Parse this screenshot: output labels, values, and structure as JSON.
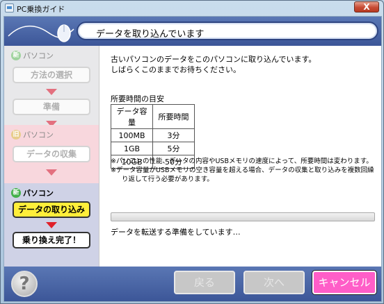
{
  "window": {
    "title": "PC乗換ガイド",
    "close_label": "X"
  },
  "header": {
    "title": "データを取り込んでいます"
  },
  "sidebar": {
    "new1_label": "パソコン",
    "new1_badge": "新",
    "step_method": "方法の選択",
    "step_prepare": "準備",
    "old_label": "パソコン",
    "old_badge": "旧",
    "step_collect": "データの収集",
    "new2_label": "パソコン",
    "new2_badge": "新",
    "step_import": "データの取り込み",
    "step_complete": "乗り換え完了！"
  },
  "main": {
    "message_line1": "古いパソコンのデータをこのパソコンに取り込んでいます。",
    "message_line2": "しばらくこのままでお待ちください。",
    "time_title": "所要時間の目安",
    "table": {
      "headers": [
        "データ容量",
        "所要時間"
      ],
      "rows": [
        [
          "100MB",
          "3分"
        ],
        [
          "1GB",
          "5分"
        ],
        [
          "10GB",
          "50分"
        ]
      ]
    },
    "note1": "※パソコンの性能、データの内容やUSBメモリの速度によって、所要時間は変わります。",
    "note2": "※データ容量がUSBメモリの空き容量を超える場合、データの収集と取り込みを複数回繰り返して行う必要があります。",
    "progress": 0,
    "status": "データを転送する準備をしています…"
  },
  "footer": {
    "help": "?",
    "back": "戻る",
    "next": "次へ",
    "cancel": "キャンセル"
  },
  "colors": {
    "header_band": "#3c5698",
    "active_step": "#ffee3a",
    "cancel_button": "#ff5ec8",
    "old_section": "#f8d7dd",
    "new_badge": "#43b04a",
    "old_badge": "#e6b84a"
  }
}
